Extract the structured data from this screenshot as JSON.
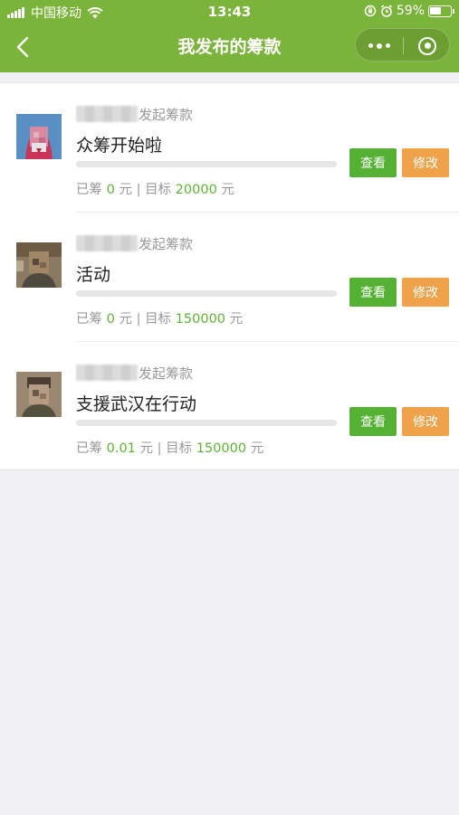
{
  "status_bar": {
    "carrier": "中国移动",
    "time": "13:43",
    "battery_percent": "59%",
    "battery_level": 0.59,
    "icons": [
      "signal-icon",
      "wifi-icon",
      "rotation-lock-icon",
      "alarm-icon",
      "battery-icon"
    ]
  },
  "nav": {
    "title": "我发布的筹款",
    "back_icon": "chevron-left-icon",
    "more_icon": "more-dots-icon",
    "close_icon": "target-close-icon"
  },
  "colors": {
    "header_green": "#7bb43a",
    "accent_green": "#5cb531",
    "view_button": "#55b134",
    "edit_button": "#f0a24a",
    "page_bg": "#efeff4"
  },
  "campaigns": [
    {
      "initiator_suffix": "发起筹款",
      "title": "众筹开始啦",
      "raised_label": "已筹",
      "raised_value": "0",
      "unit": "元",
      "separator": "|",
      "target_label": "目标",
      "target_value": "20000",
      "progress": 0,
      "view_label": "查看",
      "edit_label": "修改"
    },
    {
      "initiator_suffix": "发起筹款",
      "title": "活动",
      "raised_label": "已筹",
      "raised_value": "0",
      "unit": "元",
      "separator": "|",
      "target_label": "目标",
      "target_value": "150000",
      "progress": 0,
      "view_label": "查看",
      "edit_label": "修改"
    },
    {
      "initiator_suffix": "发起筹款",
      "title": "支援武汉在行动",
      "raised_label": "已筹",
      "raised_value": "0.01",
      "unit": "元",
      "separator": "|",
      "target_label": "目标",
      "target_value": "150000",
      "progress": 6.67e-05,
      "view_label": "查看",
      "edit_label": "修改"
    }
  ]
}
